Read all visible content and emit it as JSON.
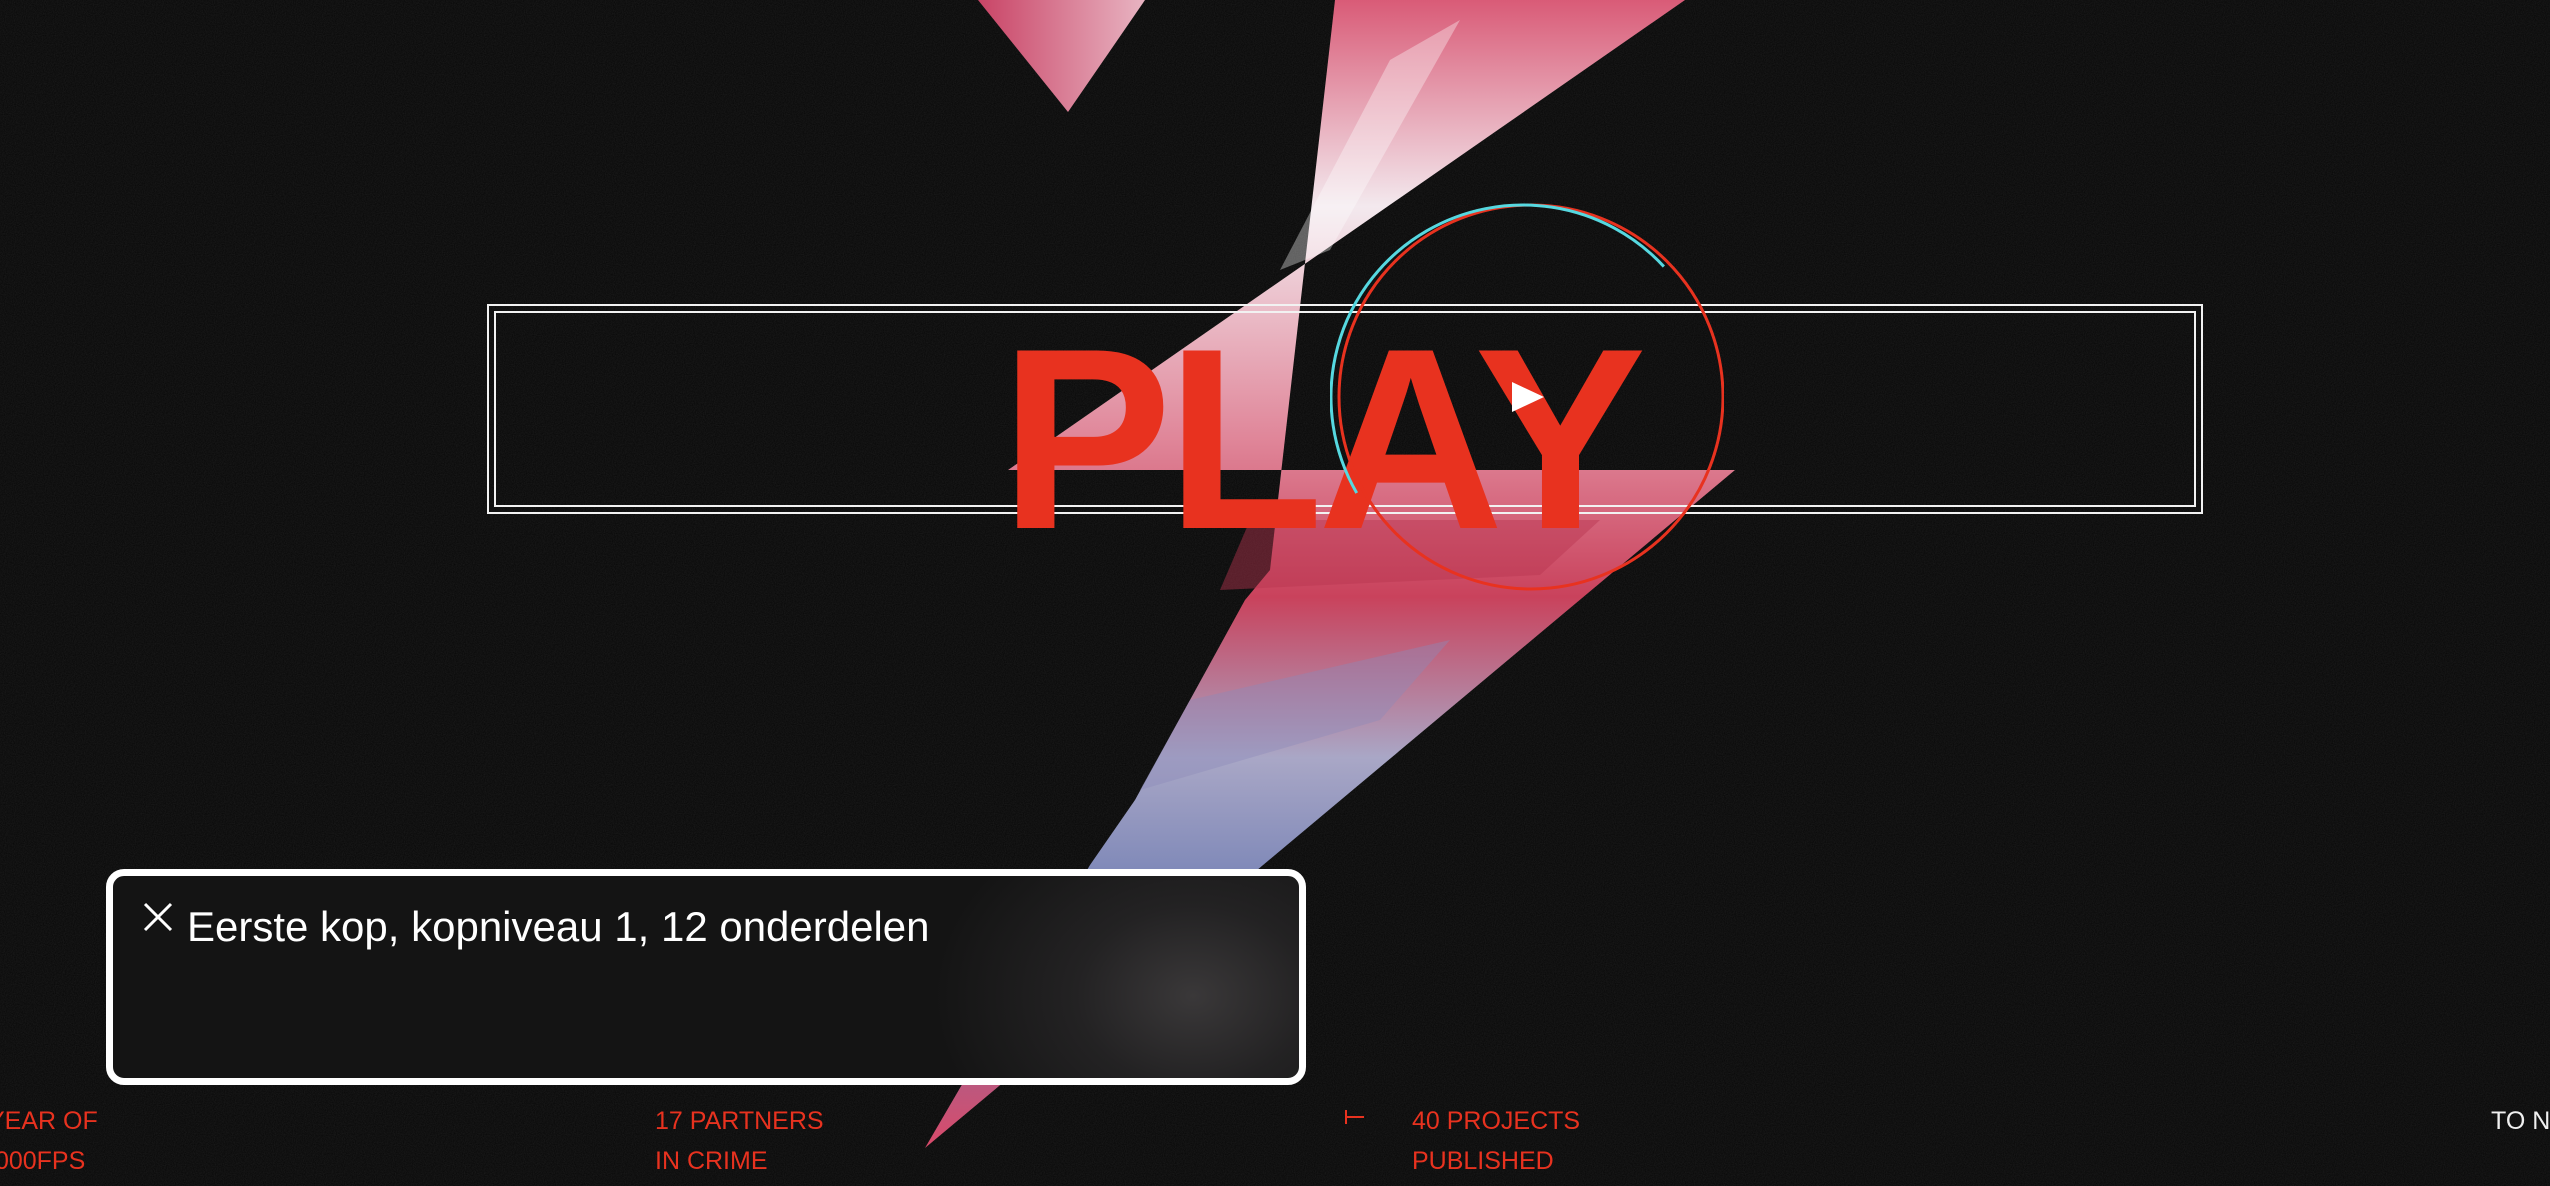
{
  "hero": {
    "word": "PLAY",
    "play_button_icon": "play-triangle-icon"
  },
  "caption": {
    "close_icon": "close-icon",
    "text": "Eerste kop, kopniveau 1, 12 onderdelen"
  },
  "stats": {
    "year": {
      "line1": "YEAR OF",
      "line2": ",000FPS"
    },
    "partners": {
      "line1": "17 PARTNERS",
      "line2": "IN CRIME"
    },
    "projects": {
      "line1": "40 PROJECTS",
      "line2": "PUBLISHED"
    }
  },
  "nav": {
    "next_label": "TO N"
  },
  "colors": {
    "accent": "#e8321f",
    "cyan": "#56d8e0",
    "background": "#060606",
    "frame": "#f2f2f2"
  }
}
